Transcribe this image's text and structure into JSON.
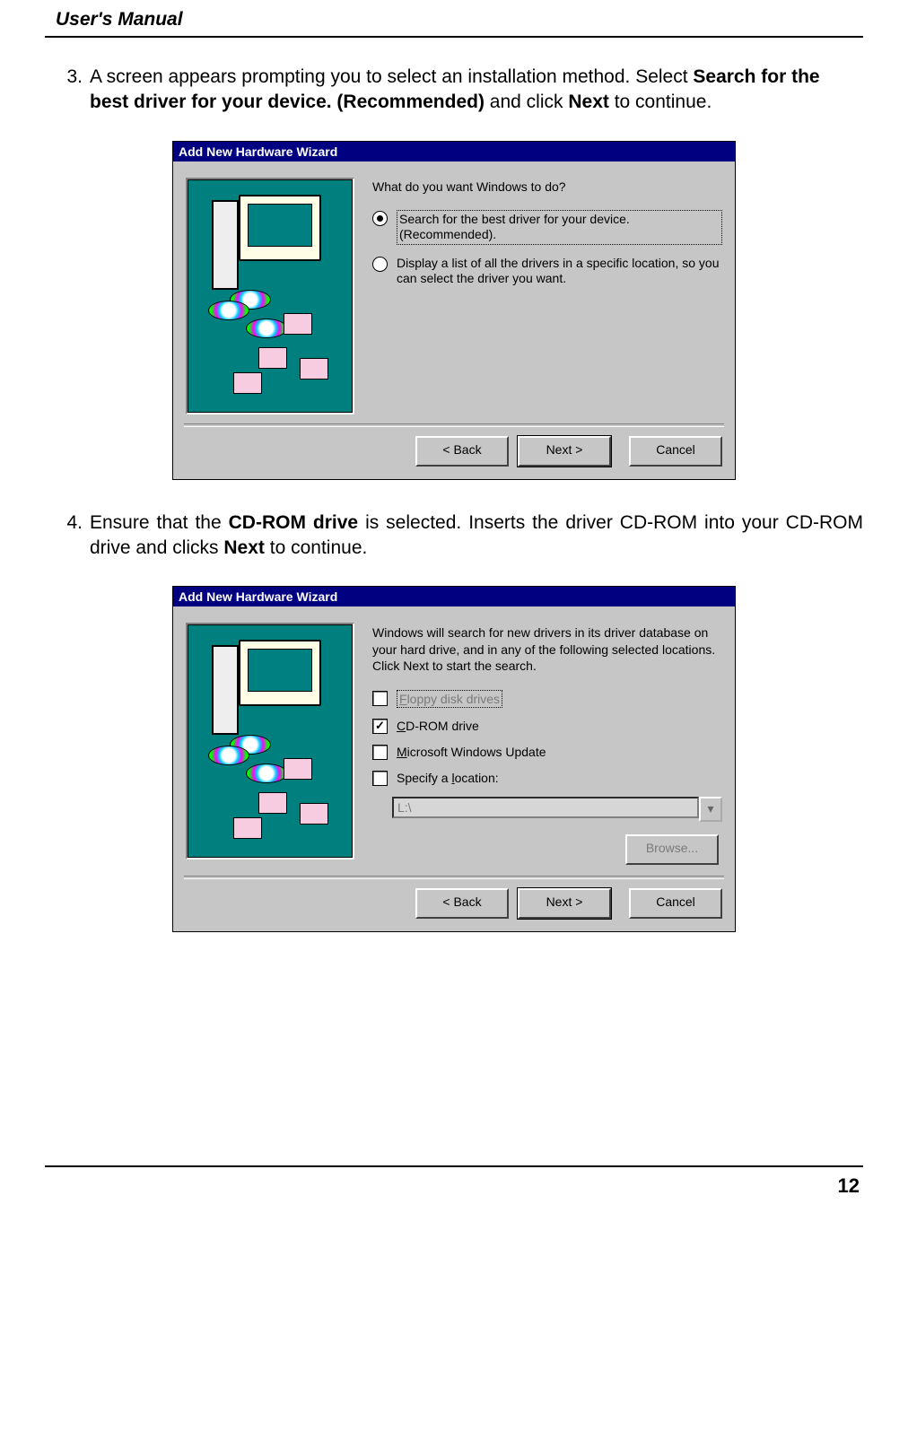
{
  "header": {
    "title": "User's Manual"
  },
  "steps": {
    "s3": {
      "num": "3.",
      "text_a": "A screen appears prompting you to select an installation method. Select ",
      "bold_a": "Search for the best driver for your device. (Recommended)",
      "text_b": " and click ",
      "bold_b": "Next",
      "text_c": " to continue."
    },
    "s4": {
      "num": "4.",
      "text_a": "Ensure that the ",
      "bold_a": "CD-ROM drive",
      "text_b": " is selected. Inserts the driver CD-ROM into your CD-ROM drive and clicks ",
      "bold_b": "Next",
      "text_c": " to continue."
    }
  },
  "dlg1": {
    "title": "Add New Hardware Wizard",
    "prompt": "What do you want Windows to do?",
    "opt1": "Search for the best driver for your device. (Recommended).",
    "opt2": "Display a list of all the drivers in a specific location, so you can select the driver you want.",
    "back": "< Back",
    "next": "Next >",
    "cancel": "Cancel"
  },
  "dlg2": {
    "title": "Add New Hardware Wizard",
    "intro": "Windows will search for new drivers in its driver database on your hard drive, and in any of the following selected locations. Click Next to start the search.",
    "floppy_pre": "F",
    "floppy_rest": "loppy disk drives",
    "cdrom_pre": "C",
    "cdrom_rest": "D-ROM drive",
    "winup_pre": "M",
    "winup_rest": "icrosoft Windows Update",
    "loc_label": "Specify a location:",
    "loc_pre": "l",
    "loc_value": "L:\\",
    "browse": "Browse...",
    "back": "< Back",
    "next": "Next >",
    "cancel": "Cancel"
  },
  "footer": {
    "page": "12"
  }
}
